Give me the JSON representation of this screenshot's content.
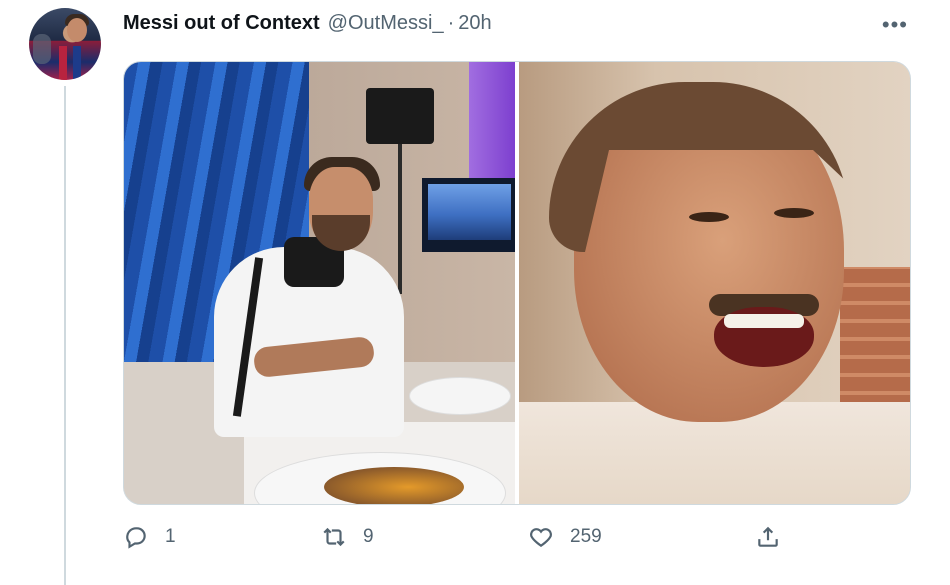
{
  "tweet": {
    "author_name": "Messi out of Context",
    "handle": "@OutMessi_",
    "separator": "·",
    "time": "20h",
    "more_label": "•••"
  },
  "media": {
    "left_image": "Messi smiling at dinner table",
    "right_image": "Man laughing with mustache"
  },
  "actions": {
    "reply_count": "1",
    "retweet_count": "9",
    "like_count": "259"
  },
  "colors": {
    "secondary_text": "#536471",
    "primary_text": "#0f1419",
    "thread_line": "#cfd9de"
  },
  "icons": [
    "reply-icon",
    "retweet-icon",
    "like-icon",
    "share-icon",
    "more-icon"
  ]
}
